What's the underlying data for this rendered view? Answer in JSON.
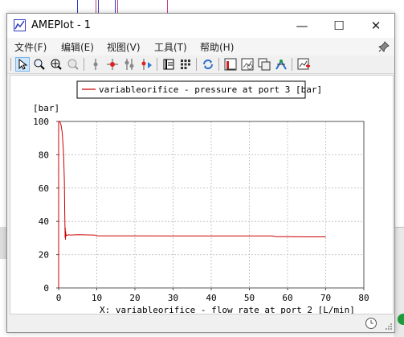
{
  "window": {
    "title": "AMEPlot - 1",
    "minimize": "—",
    "maximize": "☐",
    "close": "✕"
  },
  "menu": [
    "文件(F)",
    "编辑(E)",
    "视图(V)",
    "工具(T)",
    "帮助(H)"
  ],
  "toolbar": {
    "tools": [
      "pointer-tool",
      "zoom-tool",
      "zoom-fit-tool",
      "zoom-out-tool",
      "marker-tool",
      "crosshair-tool",
      "multi-marker-tool",
      "marker-play-tool",
      "data-table-tool",
      "grid-tool",
      "refresh-tool",
      "plot-type-tool",
      "properties-tool",
      "copy-tool",
      "export-tool",
      "add-plot-tool"
    ]
  },
  "colors": {
    "series": "#cc0000",
    "grid": "#c8c8c8",
    "active_tool": "#cde6ff"
  },
  "chart_data": {
    "type": "line",
    "legend": "variableorifice - pressure at port 3 [bar]",
    "legend_position": "top",
    "xlabel": "X: variableorifice - flow rate at port 2 [L/min]",
    "ylabel": "[bar]",
    "xlim": [
      0,
      80
    ],
    "ylim": [
      0,
      100
    ],
    "x_ticks": [
      "0",
      "10",
      "20",
      "30",
      "40",
      "50",
      "60",
      "70",
      "80"
    ],
    "y_ticks": [
      "0",
      "20",
      "40",
      "60",
      "80",
      "100"
    ],
    "grid": true,
    "series": [
      {
        "name": "variableorifice - pressure at port 3 [bar]",
        "x": [
          0,
          0,
          0.3,
          0.6,
          0.9,
          1.1,
          1.3,
          1.5,
          1.6,
          1.7,
          1.75,
          1.8,
          1.85,
          1.9,
          2.0,
          2.2,
          2.6,
          3.0,
          5,
          9.5,
          10,
          20,
          30,
          40,
          50,
          56,
          57,
          60,
          65,
          70
        ],
        "y": [
          0,
          100,
          100,
          98,
          94,
          88,
          80,
          65,
          45,
          30,
          36,
          29,
          34,
          31,
          32,
          31.5,
          32,
          31.8,
          32,
          31.8,
          31.3,
          31.3,
          31.2,
          31.2,
          31.2,
          31.2,
          30.8,
          30.8,
          30.7,
          30.7
        ]
      }
    ]
  }
}
